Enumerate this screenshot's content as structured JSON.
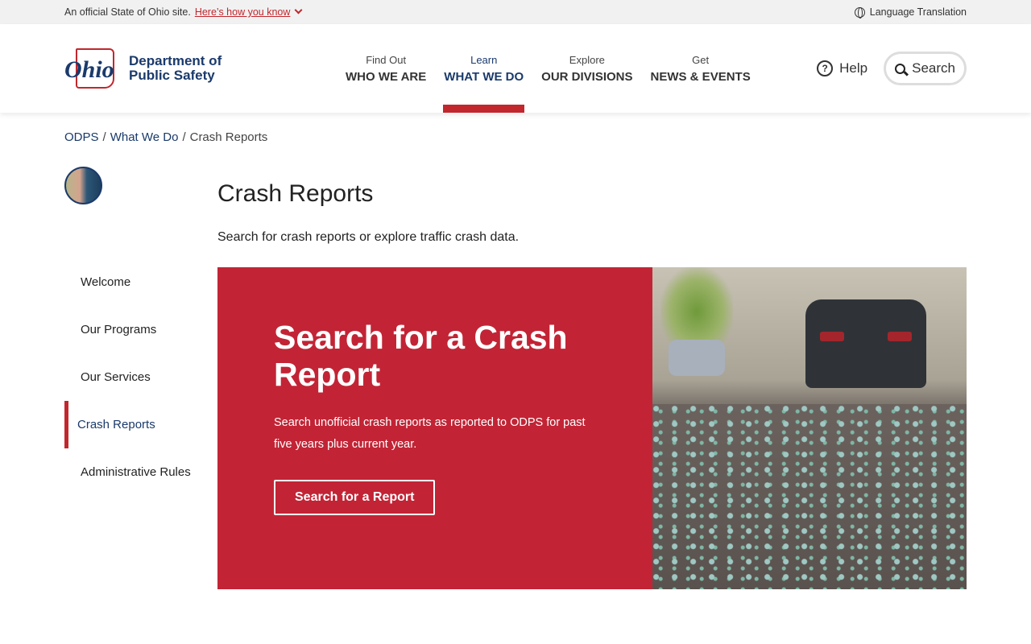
{
  "topbar": {
    "official": "An official State of Ohio site.",
    "how_link": "Here’s how you know",
    "language": "Language Translation"
  },
  "header": {
    "logo_script": "Ohio",
    "logo_line1": "Department of",
    "logo_line2": "Public Safety",
    "nav": [
      {
        "small": "Find Out",
        "big": "WHO WE ARE"
      },
      {
        "small": "Learn",
        "big": "WHAT WE DO",
        "active": true
      },
      {
        "small": "Explore",
        "big": "OUR DIVISIONS"
      },
      {
        "small": "Get",
        "big": "NEWS & EVENTS"
      }
    ],
    "help": "Help",
    "help_icon_glyph": "?",
    "search": "Search"
  },
  "breadcrumb": [
    {
      "label": "ODPS"
    },
    {
      "label": "What We Do"
    },
    {
      "label": "Crash Reports"
    }
  ],
  "breadcrumb_sep": "/",
  "sidebar": {
    "items": [
      {
        "label": "Welcome"
      },
      {
        "label": "Our Programs"
      },
      {
        "label": "Our Services"
      },
      {
        "label": "Crash Reports",
        "active": true
      },
      {
        "label": "Administrative Rules"
      }
    ]
  },
  "main": {
    "title": "Crash Reports",
    "intro": "Search for crash reports or explore traffic crash data.",
    "hero": {
      "heading": "Search for a Crash Report",
      "body": "Search unofficial crash reports as reported to ODPS for past five years plus current year.",
      "button": "Search for a Report"
    }
  },
  "colors": {
    "accent": "#c1272d",
    "brand": "#1a3a6b",
    "hero_bg": "#c22435"
  }
}
